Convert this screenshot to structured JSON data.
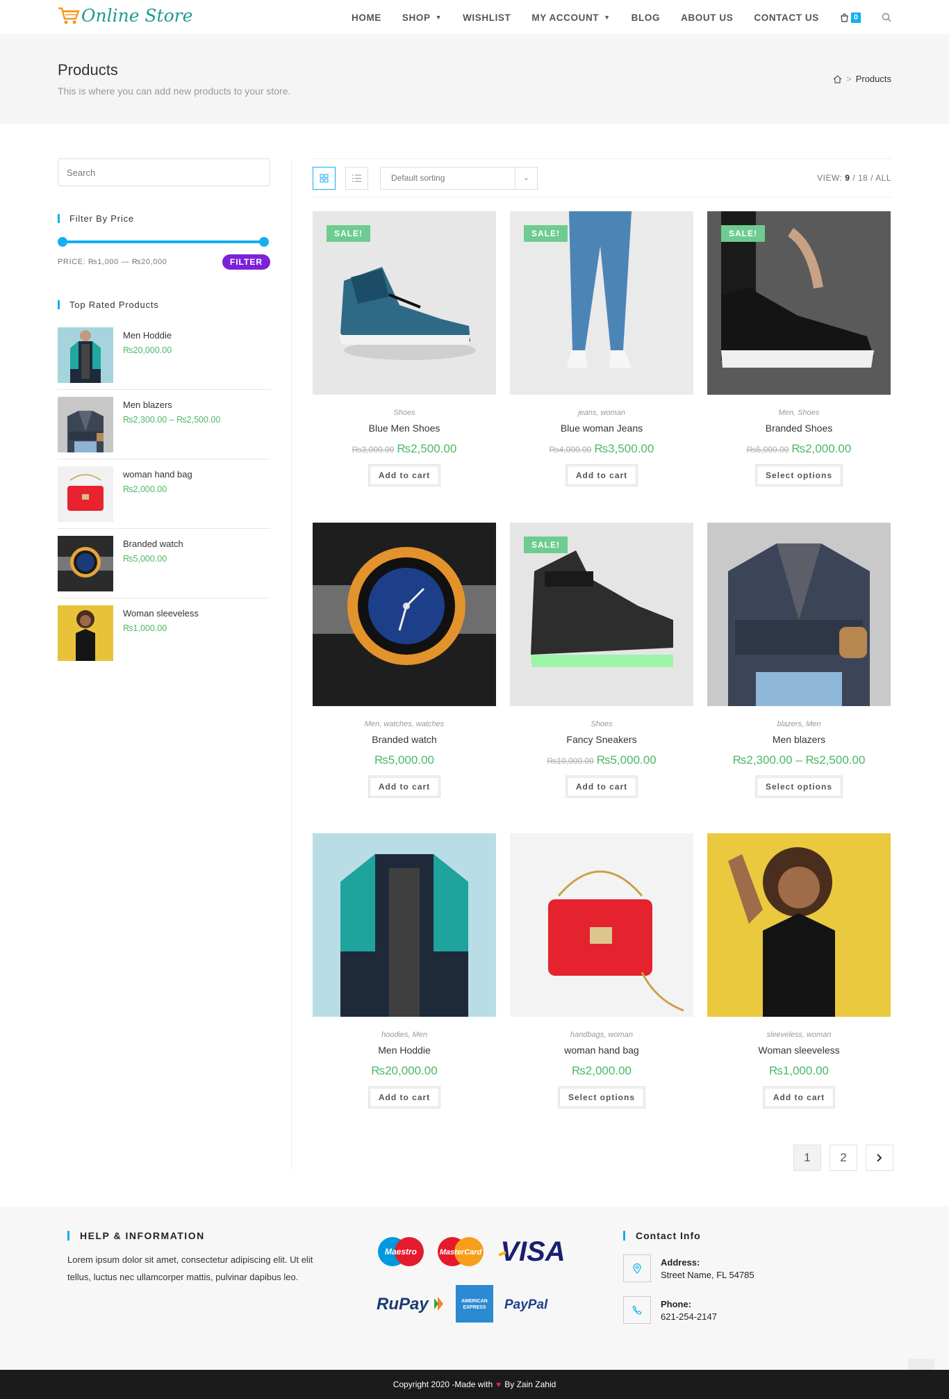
{
  "header": {
    "logo_text": "Online Store",
    "nav": [
      "HOME",
      "SHOP",
      "WISHLIST",
      "MY ACCOUNT",
      "BLOG",
      "ABOUT US",
      "CONTACT US"
    ],
    "cart_count": "0"
  },
  "page": {
    "title": "Products",
    "subtitle": "This is where you can add new products to your store.",
    "breadcrumb_current": "Products"
  },
  "sidebar": {
    "search_placeholder": "Search",
    "filter_title": "Filter By Price",
    "price_text": "PRICE: ₨1,000 — ₨20,000",
    "filter_button": "FILTER",
    "price_min": 1000,
    "price_max": 20000,
    "top_rated_title": "Top Rated Products",
    "top_rated": [
      {
        "name": "Men Hoddie",
        "price": "₨20,000.00"
      },
      {
        "name": "Men blazers",
        "price": "₨2,300.00 – ₨2,500.00"
      },
      {
        "name": "woman hand bag",
        "price": "₨2,000.00"
      },
      {
        "name": "Branded watch",
        "price": "₨5,000.00"
      },
      {
        "name": "Woman sleeveless",
        "price": "₨1,000.00"
      }
    ]
  },
  "toolbar": {
    "sort": "Default sorting",
    "view_label": "VIEW:",
    "view_current": "9",
    "view_rest": "/ 18 / ALL"
  },
  "products": [
    {
      "sale": "SALE!",
      "cats": "Shoes",
      "name": "Blue Men Shoes",
      "old": "₨3,000.00",
      "price": "₨2,500.00",
      "button": "Add to cart"
    },
    {
      "sale": "SALE!",
      "cats": "jeans, woman",
      "name": "Blue woman Jeans",
      "old": "₨4,000.00",
      "price": "₨3,500.00",
      "button": "Add to cart"
    },
    {
      "sale": "SALE!",
      "cats": "Men, Shoes",
      "name": "Branded Shoes",
      "old": "₨5,000.00",
      "price": "₨2,000.00",
      "button": "Select options"
    },
    {
      "sale": "",
      "cats": "Men, watches, watches",
      "name": "Branded watch",
      "old": "",
      "price": "₨5,000.00",
      "button": "Add to cart"
    },
    {
      "sale": "SALE!",
      "cats": "Shoes",
      "name": "Fancy Sneakers",
      "old": "₨10,000.00",
      "price": "₨5,000.00",
      "button": "Add to cart"
    },
    {
      "sale": "",
      "cats": "blazers, Men",
      "name": "Men blazers",
      "old": "",
      "price": "₨2,300.00 – ₨2,500.00",
      "button": "Select options"
    },
    {
      "sale": "",
      "cats": "hoodies, Men",
      "name": "Men Hoddie",
      "old": "",
      "price": "₨20,000.00",
      "button": "Add to cart"
    },
    {
      "sale": "",
      "cats": "handbags, woman",
      "name": "woman hand bag",
      "old": "",
      "price": "₨2,000.00",
      "button": "Select options"
    },
    {
      "sale": "",
      "cats": "sleeveless, woman",
      "name": "Woman sleeveless",
      "old": "",
      "price": "₨1,000.00",
      "button": "Add to cart"
    }
  ],
  "pagination": [
    "1",
    "2"
  ],
  "footer": {
    "help_title": "HELP & INFORMATION",
    "help_text": "Lorem ipsum dolor sit amet, consectetur adipiscing elit. Ut elit tellus, luctus nec ullamcorper mattis, pulvinar dapibus leo.",
    "payments": [
      "Maestro",
      "MasterCard",
      "VISA",
      "RuPay",
      "AMERICAN EXPRESS",
      "PayPal"
    ],
    "contact_title": "Contact Info",
    "address_label": "Address:",
    "address": "Street Name, FL 54785",
    "phone_label": "Phone:",
    "phone": "621-254-2147",
    "copyright_left": "Copyright 2020 -Made with",
    "copyright_right": "By Zain Zahid"
  },
  "colors": {
    "accent": "#13aff0",
    "price": "#4ab866",
    "sale": "#6dcc8f",
    "filter": "#7c22d8"
  }
}
